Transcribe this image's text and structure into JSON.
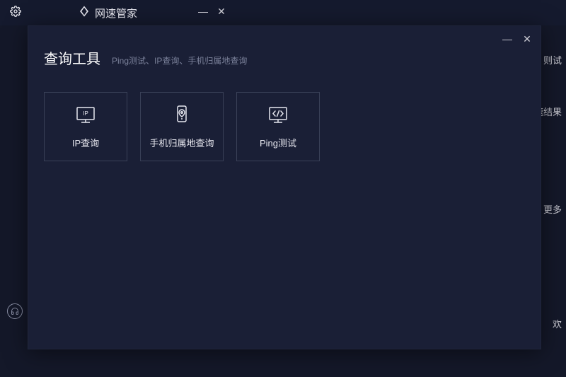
{
  "app": {
    "title": "网速管家"
  },
  "rightHints": {
    "h1": "则试",
    "h2": "速结果",
    "h3": "更多",
    "h4": "欢"
  },
  "modal": {
    "title": "查询工具",
    "subtitle": "Ping测试、IP查询、手机归属地查询",
    "tools": [
      {
        "label": "IP查询",
        "icon": "ip-monitor"
      },
      {
        "label": "手机归属地查询",
        "icon": "phone-location"
      },
      {
        "label": "Ping测试",
        "icon": "ping-code"
      }
    ]
  }
}
